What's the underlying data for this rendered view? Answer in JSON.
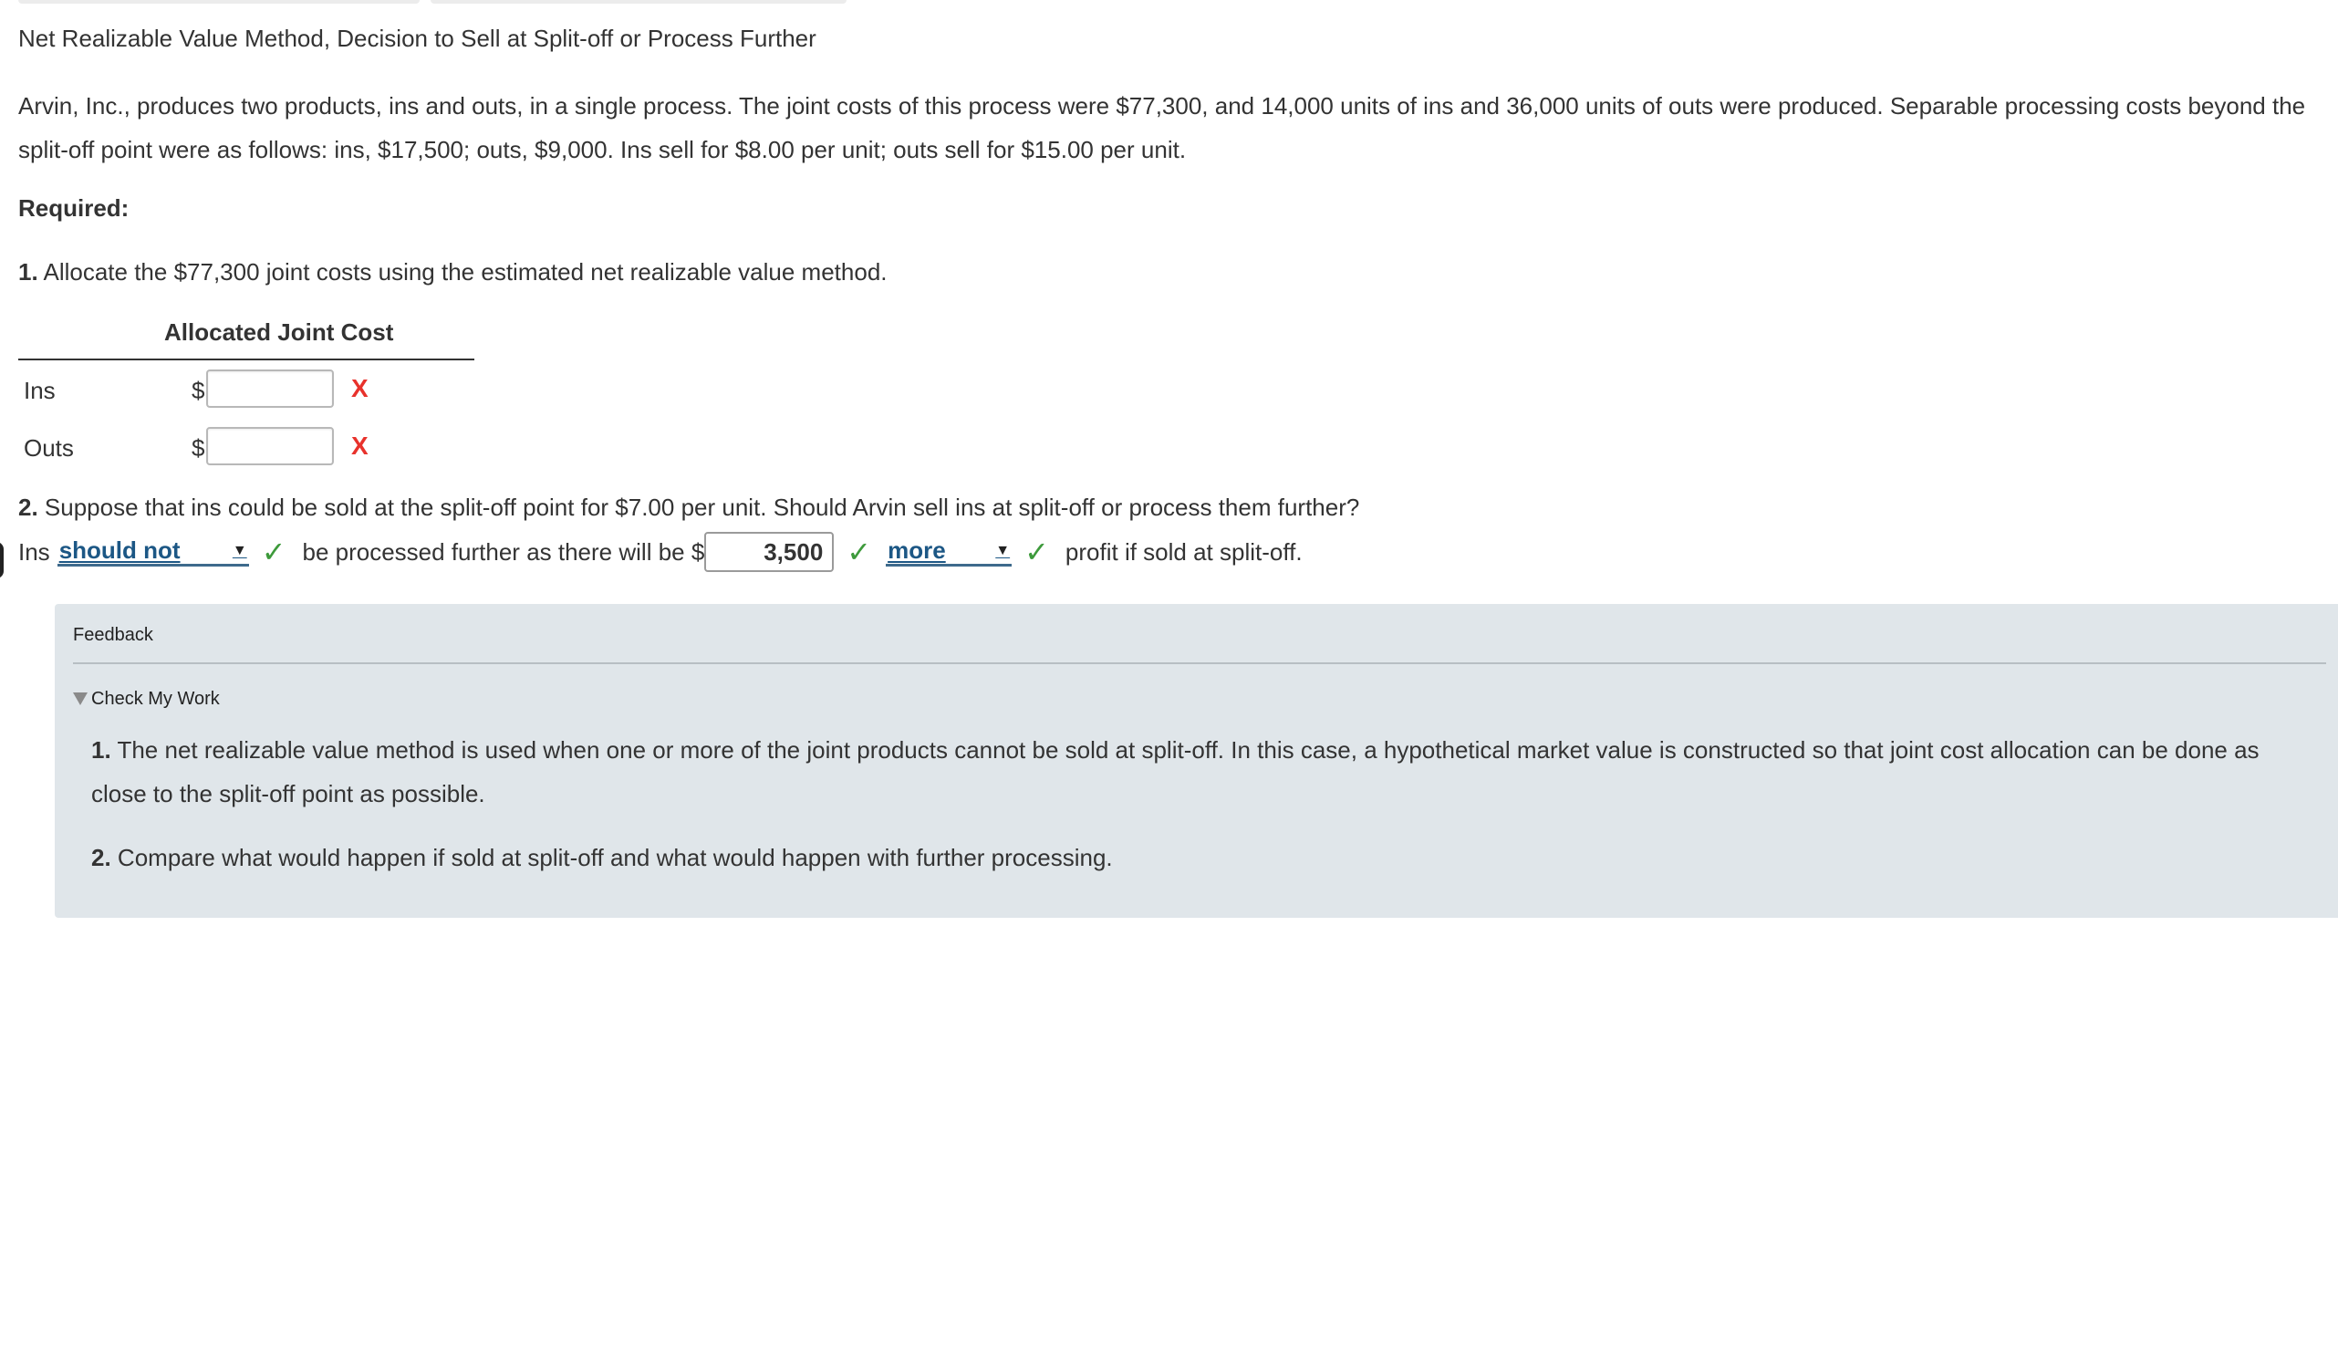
{
  "problem": {
    "title": "Net Realizable Value Method, Decision to Sell at Split-off or Process Further",
    "intro": "Arvin, Inc., produces two products, ins and outs, in a single process. The joint costs of this process were $77,300, and 14,000 units of ins and 36,000 units of outs were produced. Separable processing costs beyond the split-off point were as follows: ins, $17,500; outs, $9,000. Ins sell for $8.00 per unit; outs sell for $15.00 per unit.",
    "required_label": "Required:"
  },
  "question1": {
    "number": "1.",
    "text": "Allocate the $77,300 joint costs using the estimated net realizable value method.",
    "table_header": "Allocated Joint Cost",
    "rows": [
      {
        "label": "Ins",
        "currency": "$",
        "value": "",
        "status": "X"
      },
      {
        "label": "Outs",
        "currency": "$",
        "value": "",
        "status": "X"
      }
    ]
  },
  "question2": {
    "number": "2.",
    "text": "Suppose that ins could be sold at the split-off point for $7.00 per unit. Should Arvin sell ins at split-off or process them further?",
    "prefix": "Ins",
    "select1_value": "should not",
    "middle_text": "be processed further as there will be $",
    "amount_value": "3,500",
    "select2_value": "more",
    "suffix": "profit if sold at split-off.",
    "check_glyph": "✓"
  },
  "feedback": {
    "title": "Feedback",
    "toggle_label": "Check My Work",
    "items": [
      {
        "number": "1.",
        "text": "The net realizable value method is used when one or more of the joint products cannot be sold at split-off. In this case, a hypothetical market value is constructed so that joint cost allocation can be done as close to the split-off point as possible."
      },
      {
        "number": "2.",
        "text": "Compare what would happen if sold at split-off and what would happen with further processing."
      }
    ]
  },
  "colors": {
    "error": "#e8322c",
    "correct": "#3d9a3b",
    "link_blue": "#1c5785",
    "feedback_bg": "#e0e6ea"
  }
}
